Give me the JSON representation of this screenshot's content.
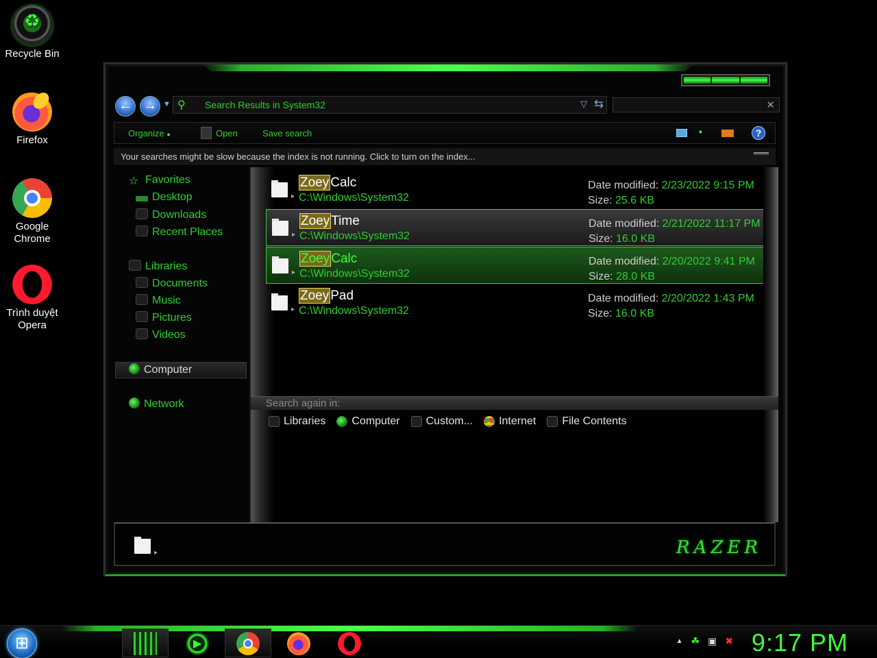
{
  "desktop": {
    "icons": [
      {
        "label": "Recycle Bin",
        "icon": "recycle-bin-icon"
      },
      {
        "label": "Firefox",
        "icon": "firefox-icon"
      },
      {
        "label": "Google Chrome",
        "icon": "chrome-icon"
      },
      {
        "label": "Trình duyệt Opera",
        "icon": "opera-icon"
      }
    ]
  },
  "window": {
    "address": {
      "text": "Search Results in System32"
    },
    "search": {
      "placeholder": ""
    },
    "toolbar": {
      "organize": "Organize",
      "open": "Open",
      "save_search": "Save search"
    },
    "infobar": {
      "text": "Your searches might be slow because the index is not running.  Click to turn on the index..."
    },
    "nav": {
      "favorites": "Favorites",
      "desktop": "Desktop",
      "downloads": "Downloads",
      "recent": "Recent Places",
      "libraries": "Libraries",
      "documents": "Documents",
      "music": "Music",
      "pictures": "Pictures",
      "videos": "Videos",
      "computer": "Computer",
      "network": "Network"
    },
    "results": [
      {
        "highlight": "Zoey",
        "rest": "Calc",
        "path": "C:\\Windows\\System32",
        "date_label": "Date modified:",
        "date": "2/23/2022 9:15 PM",
        "size_label": "Size:",
        "size": "25.6 KB"
      },
      {
        "highlight": "Zoey",
        "rest": "Time",
        "path": "C:\\Windows\\System32",
        "date_label": "Date modified:",
        "date": "2/21/2022 11:17 PM",
        "size_label": "Size:",
        "size": "16.0 KB"
      },
      {
        "highlight": "Zoey",
        "rest": "Calc",
        "path": "C:\\Windows\\System32",
        "date_label": "Date modified:",
        "date": "2/20/2022 9:41 PM",
        "size_label": "Size:",
        "size": "28.0 KB"
      },
      {
        "highlight": "Zoey",
        "rest": "Pad",
        "path": "C:\\Windows\\System32",
        "date_label": "Date modified:",
        "date": "2/20/2022 1:43 PM",
        "size_label": "Size:",
        "size": "16.0 KB"
      }
    ],
    "search_again": {
      "label": "Search again in:",
      "options": [
        "Libraries",
        "Computer",
        "Custom...",
        "Internet",
        "File Contents"
      ]
    },
    "details": {
      "brand": "RAZER"
    }
  },
  "taskbar": {
    "apps": [
      "explorer-icon",
      "media-player-icon",
      "chrome-icon",
      "firefox-icon",
      "opera-icon"
    ],
    "clock": "9:17 PM"
  },
  "colors": {
    "accent": "#2ecf2e",
    "highlight": "#3cff3c",
    "background": "#000000"
  }
}
